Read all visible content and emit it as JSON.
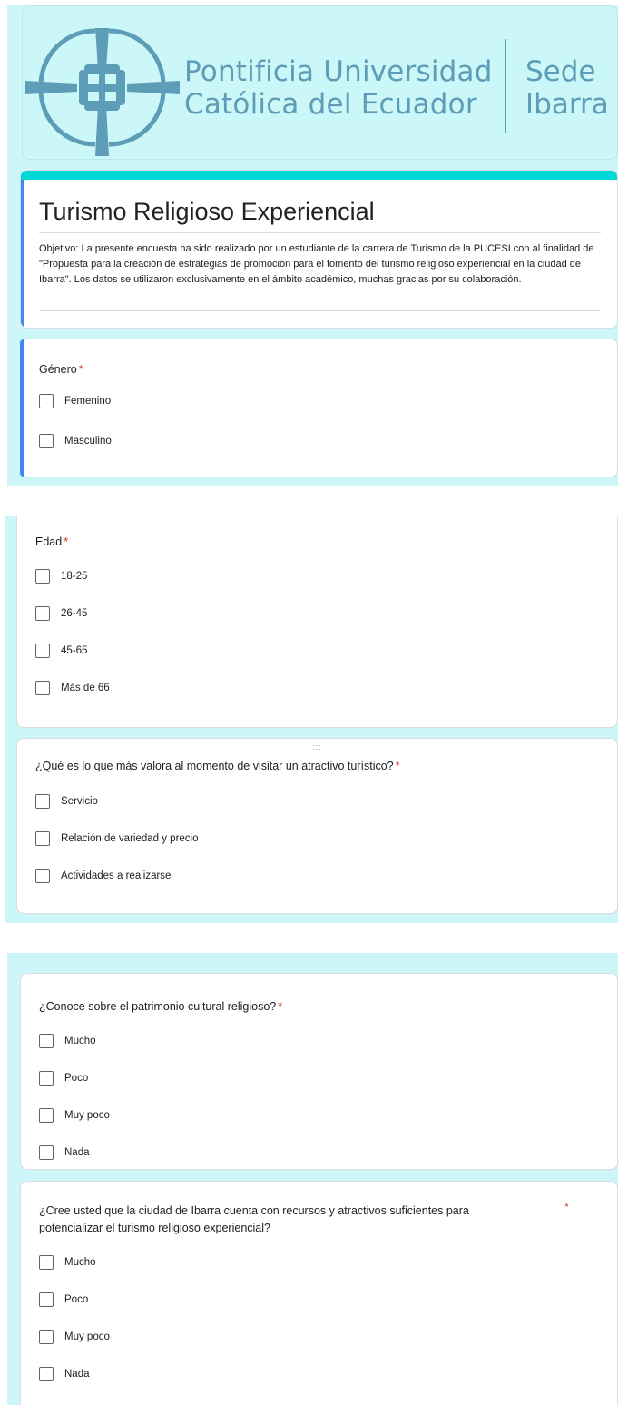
{
  "header": {
    "university_line1": "Pontificia Universidad",
    "university_line2": "Católica del Ecuador",
    "sede_line1": "Sede",
    "sede_line2": "Ibarra",
    "brand_color": "#5e9db7",
    "accent_color": "#00d8d8"
  },
  "form": {
    "title": "Turismo Religioso Experiencial",
    "description": "Objetivo: La presente encuesta ha sido realizado por un estudiante de la carrera de Turismo de la PUCESI con al finalidad de \"Propuesta para la creación de estrategias de promoción para el fomento del turismo religioso experiencial en la ciudad de Ibarra\". Los datos se utilizaron exclusivamente en el ámbito académico, muchas gracias por su colaboración."
  },
  "questions": [
    {
      "title": "Género",
      "required_mark": "*",
      "options": [
        "Femenino",
        "Masculino"
      ]
    },
    {
      "title": "Edad",
      "required_mark": "*",
      "options": [
        "18-25",
        "26-45",
        "45-65",
        "Más de 66"
      ]
    },
    {
      "title": "¿Qué es lo que más valora al momento de visitar un atractivo turístico?",
      "required_mark": "*",
      "drag_handle": ":::",
      "options": [
        "Servicio",
        "Relación de variedad y precio",
        "Actividades a realizarse"
      ]
    },
    {
      "title": "¿Conoce sobre el patrimonio cultural religioso?",
      "required_mark": "*",
      "options": [
        "Mucho",
        "Poco",
        "Muy poco",
        "Nada"
      ]
    },
    {
      "title_line1": "¿Cree usted que la ciudad de Ibarra cuenta con recursos y atractivos suficientes para",
      "title_line2": "potencializar el turismo religioso experiencial?",
      "required_mark": "*",
      "options": [
        "Mucho",
        "Poco",
        "Muy poco",
        "Nada"
      ]
    }
  ]
}
